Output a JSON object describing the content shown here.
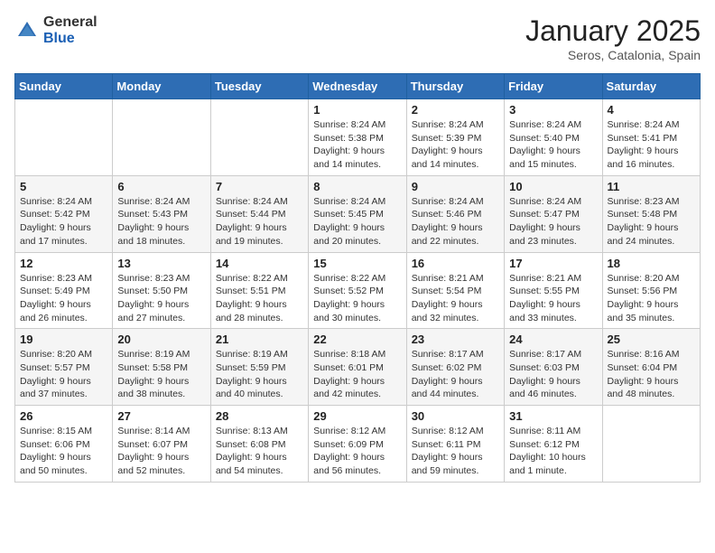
{
  "logo": {
    "general": "General",
    "blue": "Blue"
  },
  "header": {
    "month": "January 2025",
    "location": "Seros, Catalonia, Spain"
  },
  "weekdays": [
    "Sunday",
    "Monday",
    "Tuesday",
    "Wednesday",
    "Thursday",
    "Friday",
    "Saturday"
  ],
  "weeks": [
    [
      {
        "day": "",
        "sunrise": "",
        "sunset": "",
        "daylight": ""
      },
      {
        "day": "",
        "sunrise": "",
        "sunset": "",
        "daylight": ""
      },
      {
        "day": "",
        "sunrise": "",
        "sunset": "",
        "daylight": ""
      },
      {
        "day": "1",
        "sunrise": "Sunrise: 8:24 AM",
        "sunset": "Sunset: 5:38 PM",
        "daylight": "Daylight: 9 hours and 14 minutes."
      },
      {
        "day": "2",
        "sunrise": "Sunrise: 8:24 AM",
        "sunset": "Sunset: 5:39 PM",
        "daylight": "Daylight: 9 hours and 14 minutes."
      },
      {
        "day": "3",
        "sunrise": "Sunrise: 8:24 AM",
        "sunset": "Sunset: 5:40 PM",
        "daylight": "Daylight: 9 hours and 15 minutes."
      },
      {
        "day": "4",
        "sunrise": "Sunrise: 8:24 AM",
        "sunset": "Sunset: 5:41 PM",
        "daylight": "Daylight: 9 hours and 16 minutes."
      }
    ],
    [
      {
        "day": "5",
        "sunrise": "Sunrise: 8:24 AM",
        "sunset": "Sunset: 5:42 PM",
        "daylight": "Daylight: 9 hours and 17 minutes."
      },
      {
        "day": "6",
        "sunrise": "Sunrise: 8:24 AM",
        "sunset": "Sunset: 5:43 PM",
        "daylight": "Daylight: 9 hours and 18 minutes."
      },
      {
        "day": "7",
        "sunrise": "Sunrise: 8:24 AM",
        "sunset": "Sunset: 5:44 PM",
        "daylight": "Daylight: 9 hours and 19 minutes."
      },
      {
        "day": "8",
        "sunrise": "Sunrise: 8:24 AM",
        "sunset": "Sunset: 5:45 PM",
        "daylight": "Daylight: 9 hours and 20 minutes."
      },
      {
        "day": "9",
        "sunrise": "Sunrise: 8:24 AM",
        "sunset": "Sunset: 5:46 PM",
        "daylight": "Daylight: 9 hours and 22 minutes."
      },
      {
        "day": "10",
        "sunrise": "Sunrise: 8:24 AM",
        "sunset": "Sunset: 5:47 PM",
        "daylight": "Daylight: 9 hours and 23 minutes."
      },
      {
        "day": "11",
        "sunrise": "Sunrise: 8:23 AM",
        "sunset": "Sunset: 5:48 PM",
        "daylight": "Daylight: 9 hours and 24 minutes."
      }
    ],
    [
      {
        "day": "12",
        "sunrise": "Sunrise: 8:23 AM",
        "sunset": "Sunset: 5:49 PM",
        "daylight": "Daylight: 9 hours and 26 minutes."
      },
      {
        "day": "13",
        "sunrise": "Sunrise: 8:23 AM",
        "sunset": "Sunset: 5:50 PM",
        "daylight": "Daylight: 9 hours and 27 minutes."
      },
      {
        "day": "14",
        "sunrise": "Sunrise: 8:22 AM",
        "sunset": "Sunset: 5:51 PM",
        "daylight": "Daylight: 9 hours and 28 minutes."
      },
      {
        "day": "15",
        "sunrise": "Sunrise: 8:22 AM",
        "sunset": "Sunset: 5:52 PM",
        "daylight": "Daylight: 9 hours and 30 minutes."
      },
      {
        "day": "16",
        "sunrise": "Sunrise: 8:21 AM",
        "sunset": "Sunset: 5:54 PM",
        "daylight": "Daylight: 9 hours and 32 minutes."
      },
      {
        "day": "17",
        "sunrise": "Sunrise: 8:21 AM",
        "sunset": "Sunset: 5:55 PM",
        "daylight": "Daylight: 9 hours and 33 minutes."
      },
      {
        "day": "18",
        "sunrise": "Sunrise: 8:20 AM",
        "sunset": "Sunset: 5:56 PM",
        "daylight": "Daylight: 9 hours and 35 minutes."
      }
    ],
    [
      {
        "day": "19",
        "sunrise": "Sunrise: 8:20 AM",
        "sunset": "Sunset: 5:57 PM",
        "daylight": "Daylight: 9 hours and 37 minutes."
      },
      {
        "day": "20",
        "sunrise": "Sunrise: 8:19 AM",
        "sunset": "Sunset: 5:58 PM",
        "daylight": "Daylight: 9 hours and 38 minutes."
      },
      {
        "day": "21",
        "sunrise": "Sunrise: 8:19 AM",
        "sunset": "Sunset: 5:59 PM",
        "daylight": "Daylight: 9 hours and 40 minutes."
      },
      {
        "day": "22",
        "sunrise": "Sunrise: 8:18 AM",
        "sunset": "Sunset: 6:01 PM",
        "daylight": "Daylight: 9 hours and 42 minutes."
      },
      {
        "day": "23",
        "sunrise": "Sunrise: 8:17 AM",
        "sunset": "Sunset: 6:02 PM",
        "daylight": "Daylight: 9 hours and 44 minutes."
      },
      {
        "day": "24",
        "sunrise": "Sunrise: 8:17 AM",
        "sunset": "Sunset: 6:03 PM",
        "daylight": "Daylight: 9 hours and 46 minutes."
      },
      {
        "day": "25",
        "sunrise": "Sunrise: 8:16 AM",
        "sunset": "Sunset: 6:04 PM",
        "daylight": "Daylight: 9 hours and 48 minutes."
      }
    ],
    [
      {
        "day": "26",
        "sunrise": "Sunrise: 8:15 AM",
        "sunset": "Sunset: 6:06 PM",
        "daylight": "Daylight: 9 hours and 50 minutes."
      },
      {
        "day": "27",
        "sunrise": "Sunrise: 8:14 AM",
        "sunset": "Sunset: 6:07 PM",
        "daylight": "Daylight: 9 hours and 52 minutes."
      },
      {
        "day": "28",
        "sunrise": "Sunrise: 8:13 AM",
        "sunset": "Sunset: 6:08 PM",
        "daylight": "Daylight: 9 hours and 54 minutes."
      },
      {
        "day": "29",
        "sunrise": "Sunrise: 8:12 AM",
        "sunset": "Sunset: 6:09 PM",
        "daylight": "Daylight: 9 hours and 56 minutes."
      },
      {
        "day": "30",
        "sunrise": "Sunrise: 8:12 AM",
        "sunset": "Sunset: 6:11 PM",
        "daylight": "Daylight: 9 hours and 59 minutes."
      },
      {
        "day": "31",
        "sunrise": "Sunrise: 8:11 AM",
        "sunset": "Sunset: 6:12 PM",
        "daylight": "Daylight: 10 hours and 1 minute."
      },
      {
        "day": "",
        "sunrise": "",
        "sunset": "",
        "daylight": ""
      }
    ]
  ]
}
